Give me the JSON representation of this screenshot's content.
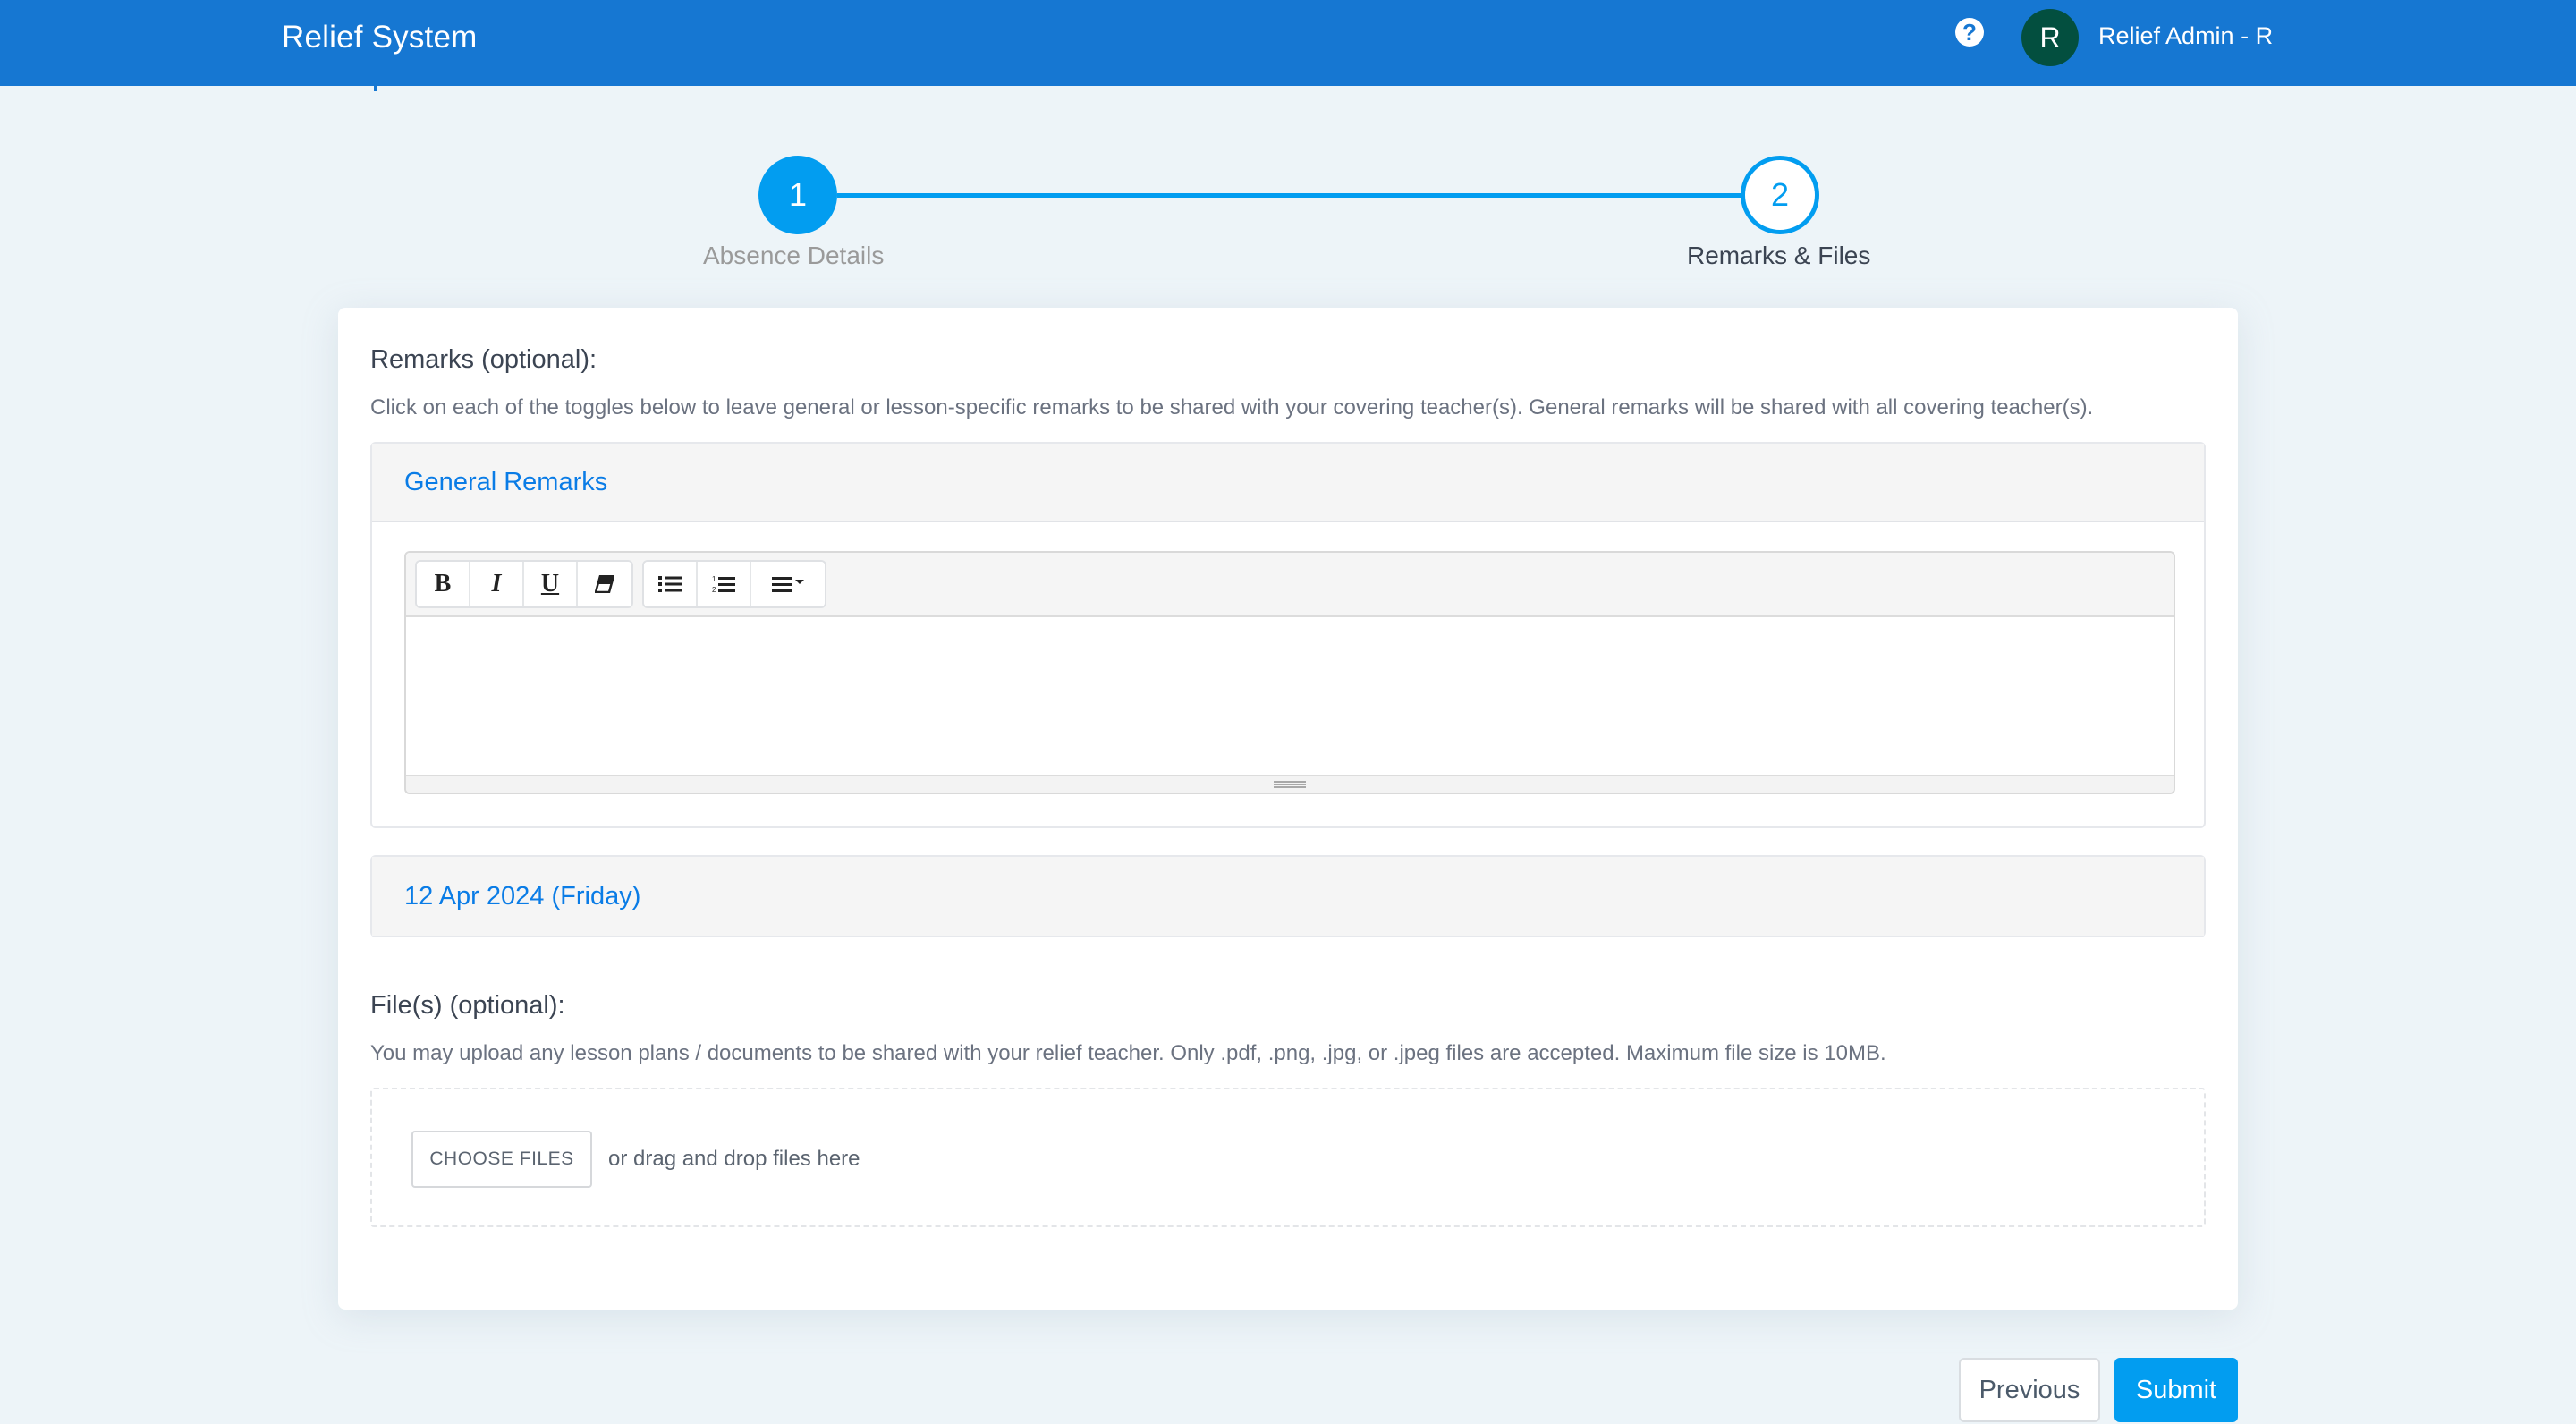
{
  "header": {
    "app_title": "Relief System",
    "help_icon": "question-circle-icon",
    "avatar_initial": "R",
    "user_name": "Relief Admin - R"
  },
  "stepper": {
    "steps": [
      {
        "number": "1",
        "label": "Absence Details",
        "state": "completed"
      },
      {
        "number": "2",
        "label": "Remarks & Files",
        "state": "active"
      }
    ],
    "current_step": 2,
    "total_steps": 2
  },
  "remarks": {
    "title": "Remarks (optional):",
    "description": "Click on each of the toggles below to leave general or lesson-specific remarks to be shared with your covering teacher(s). General remarks will be shared with all covering teacher(s).",
    "general_panel": {
      "title": "General Remarks",
      "editor_value": "",
      "toolbar": [
        {
          "name": "bold",
          "glyph": "B"
        },
        {
          "name": "italic",
          "glyph": "I"
        },
        {
          "name": "underline",
          "glyph": "U"
        },
        {
          "name": "clear-format",
          "glyph": "eraser-icon"
        },
        {
          "name": "unordered-list",
          "glyph": "list-ul-icon"
        },
        {
          "name": "ordered-list",
          "glyph": "list-ol-icon"
        },
        {
          "name": "align",
          "glyph": "align-left-icon"
        }
      ]
    },
    "date_panel": {
      "title": "12 Apr 2024 (Friday)"
    }
  },
  "files": {
    "title": "File(s) (optional):",
    "description": "You may upload any lesson plans / documents to be shared with your relief teacher. Only .pdf, .png, .jpg, or .jpeg files are accepted. Maximum file size is 10MB.",
    "choose_label": "CHOOSE FILES",
    "drop_text": "or drag and drop files here"
  },
  "actions": {
    "previous_label": "Previous",
    "submit_label": "Submit"
  },
  "colors": {
    "header_bg": "#1677d2",
    "accent": "#029df0",
    "link": "#0a7ce6",
    "avatar_bg": "#034f3f"
  }
}
